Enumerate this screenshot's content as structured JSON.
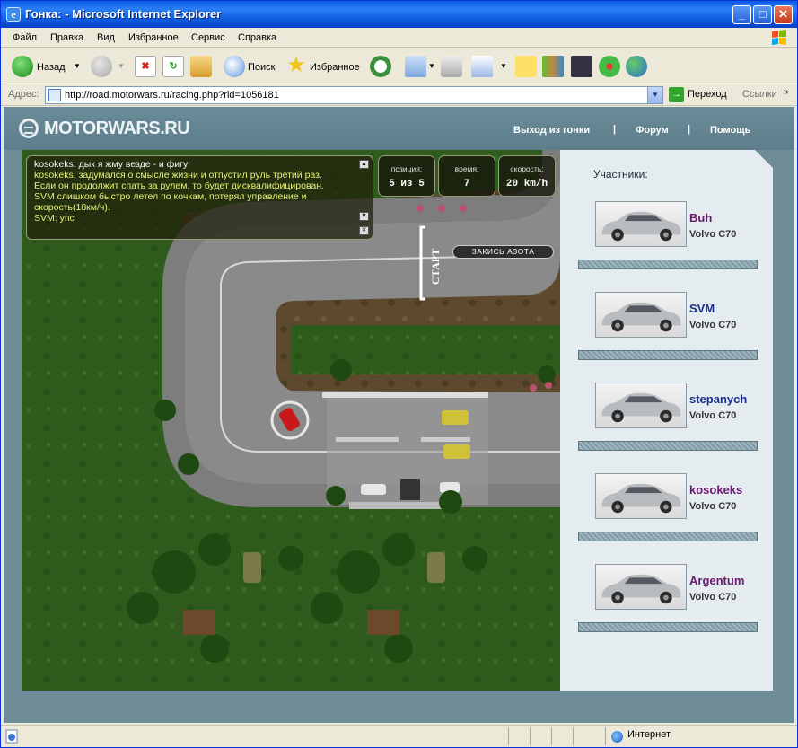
{
  "window": {
    "title": "Гонка: - Microsoft Internet Explorer",
    "minimize": "_",
    "maximize": "□",
    "close": "✕"
  },
  "menu": [
    "Файл",
    "Правка",
    "Вид",
    "Избранное",
    "Сервис",
    "Справка"
  ],
  "toolbar": {
    "back": "Назад",
    "search": "Поиск",
    "favorites": "Избранное"
  },
  "address": {
    "label": "Адрес:",
    "url": "http://road.motorwars.ru/racing.php?rid=1056181",
    "go": "Переход",
    "links": "Ссылки"
  },
  "site": {
    "logo": "MOTORWARS.RU",
    "nav": [
      "Выход из гонки",
      "Форум",
      "Помощь"
    ],
    "separator": "|"
  },
  "chat": {
    "lines": [
      "kosokeks: дык я жму везде - и фигу",
      "kosokeks, задумался о смысле жизни и отпустил руль третий раз.",
      "Если он продолжит спать за рулем, то будет дисквалифицирован.",
      "SVM слишком быстро летел по кочкам, потерял управление и",
      "скорость(18км/ч).",
      "SVM: упс"
    ]
  },
  "stats": {
    "position_label": "позиция:",
    "position_value": "5 из 5",
    "time_label": "время:",
    "time_value": "7",
    "speed_label": "скорость:",
    "speed_value": "20 km/h"
  },
  "race": {
    "nitro_button": "ЗАКИСЬ АЗОТА",
    "start_label": "СТАРТ"
  },
  "participants": {
    "title": "Участники:",
    "items": [
      {
        "name": "Buh",
        "car": "Volvo C70",
        "color": "#6b1a6e"
      },
      {
        "name": "SVM",
        "car": "Volvo C70",
        "color": "#1a2f8c"
      },
      {
        "name": "stepanych",
        "car": "Volvo C70",
        "color": "#1a2f8c"
      },
      {
        "name": "kosokeks",
        "car": "Volvo C70",
        "color": "#6b1a6e"
      },
      {
        "name": "Argentum",
        "car": "Volvo C70",
        "color": "#6b1a6e"
      }
    ]
  },
  "status": {
    "zone": "Интернет"
  }
}
